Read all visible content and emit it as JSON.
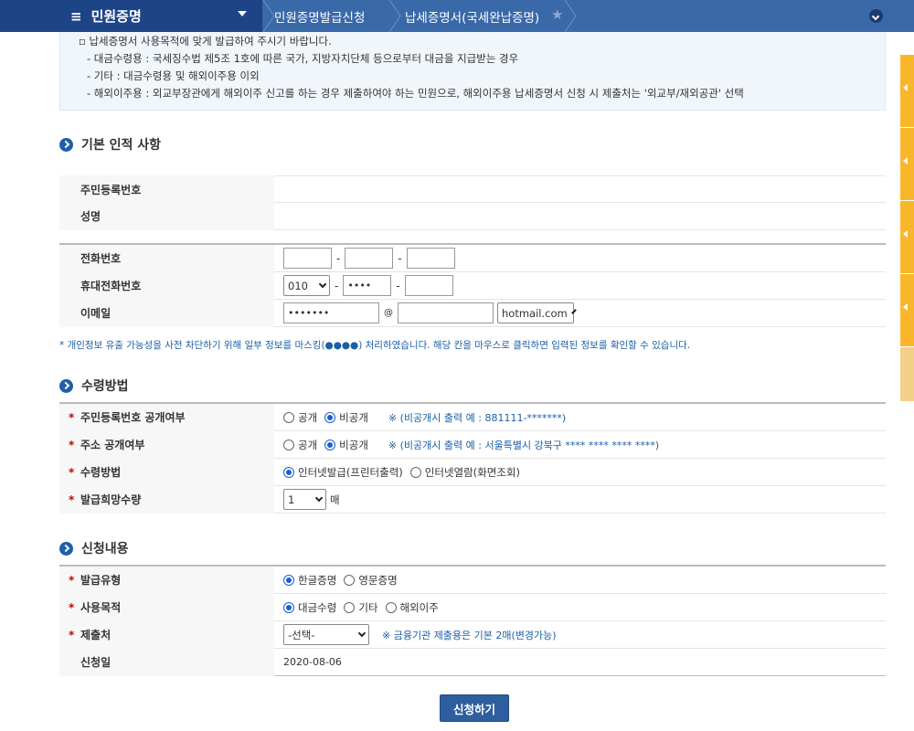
{
  "topbar": {
    "menu_title": "민원증명",
    "crumb1": "민원증명발급신청",
    "crumb2": "납세증명서(국세완납증명)"
  },
  "notice": {
    "line1": "납세증명서 사용목적에 맞게 발급하여 주시기 바랍니다.",
    "line2": "- 대금수령용 : 국세징수법 제5조 1호에 따른 국가, 지방자치단체 등으로부터 대금을 지급받는 경우",
    "line3": "- 기타 : 대금수령용 및 해외이주용 이외",
    "line4": "- 해외이주용 : 외교부장관에게 해외이주 신고를 하는 경우 제출하여야 하는 민원으로, 해외이주용 납세증명서 신청 시 제출처는 '외교부/재외공관' 선택"
  },
  "section1": {
    "title": "기본 인적 사항",
    "rrn_label": "주민등록번호",
    "name_label": "성명",
    "phone_label": "전화번호",
    "mobile_label": "휴대전화번호",
    "mobile_prefix": "010",
    "mobile_mid": "••••",
    "email_label": "이메일",
    "email_id": "•••••••",
    "at": "@",
    "email_domain": "hotmail.com",
    "privacy_note": "* 개인정보 유출 가능성을 사전 차단하기 위해 일부 정보를 마스킹(●●●●) 처리하였습니다. 해당 칸을 마우스로 클릭하면 입력된 정보를 확인할 수 있습니다."
  },
  "section2": {
    "title": "수령방법",
    "rrn_public_label": "주민등록번호 공개여부",
    "addr_public_label": "주소 공개여부",
    "receive_label": "수령방법",
    "count_label": "발급희망수량",
    "opt_public": "공개",
    "opt_private": "비공개",
    "rrn_hint": "※ (비공개시 출력 예 : 881111-*******)",
    "addr_hint": "※ (비공개시 출력 예 : 서울특별시 강북구 **** **** **** ****)",
    "opt_print": "인터넷발급(프린터출력)",
    "opt_view": "인터넷열람(화면조회)",
    "count_value": "1",
    "count_unit": "매"
  },
  "section3": {
    "title": "신청내용",
    "type_label": "발급유형",
    "opt_korean": "한글증명",
    "opt_english": "영문증명",
    "purpose_label": "사용목적",
    "opt_payment": "대금수령",
    "opt_other": "기타",
    "opt_emigrate": "해외이주",
    "submit_to_label": "제출처",
    "submit_to_value": "-선택-",
    "submit_hint": "※ 금융기관 제출용은 기본 2매(변경가능)",
    "date_label": "신청일",
    "date_value": "2020-08-06"
  },
  "apply_button": "신청하기",
  "colors": {
    "topbar": "#3a69aa",
    "menu": "#1d4486",
    "accent": "#1f5fa8",
    "side": "#f9b62b"
  }
}
